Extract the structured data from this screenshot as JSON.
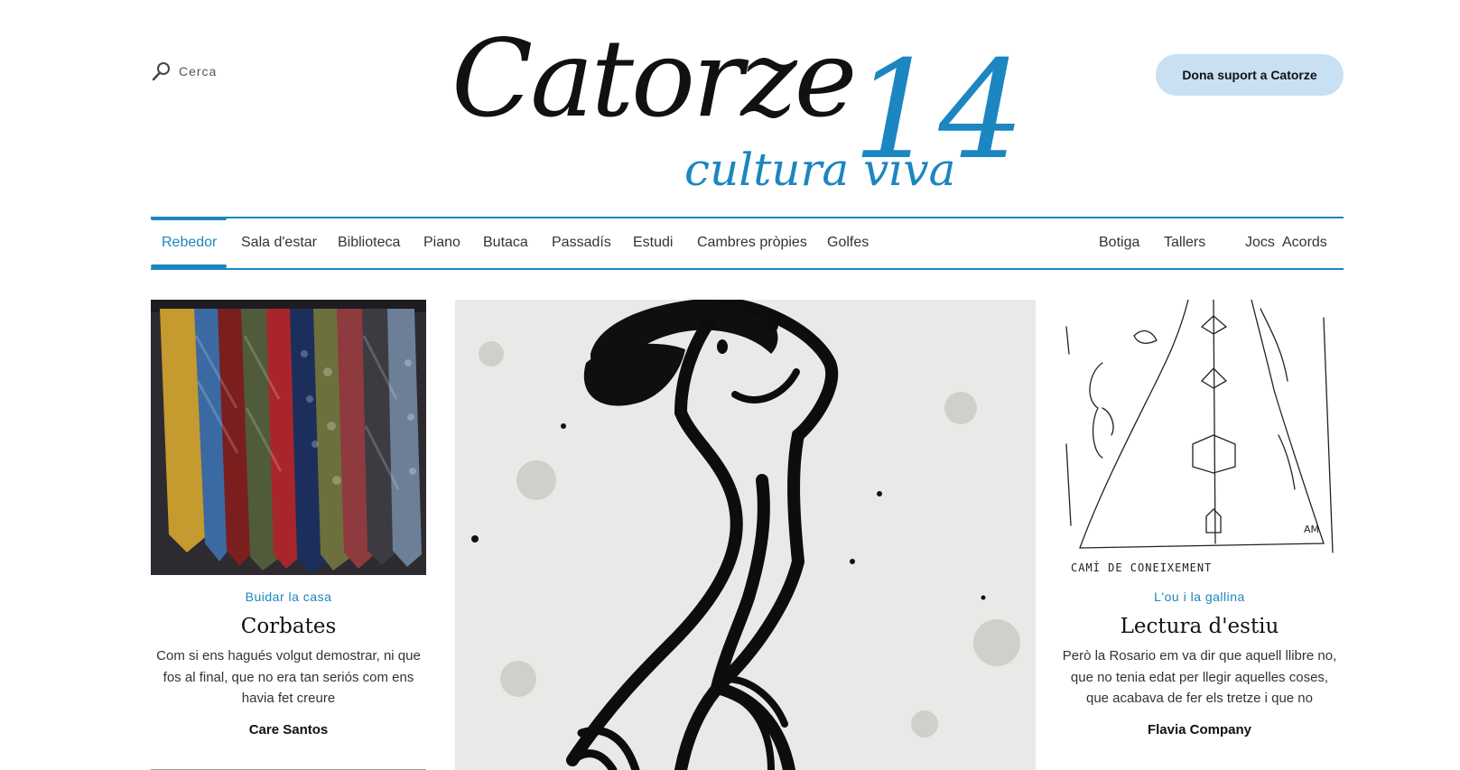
{
  "header": {
    "search_label": "Cerca",
    "logo_word": "Catorze",
    "logo_number": "14",
    "logo_tagline": "cultura viva",
    "support_button": "Dona suport a Catorze"
  },
  "nav": {
    "left": [
      "Rebedor",
      "Sala d'estar",
      "Biblioteca",
      "Piano",
      "Butaca",
      "Passadís",
      "Estudi",
      "Cambres pròpies",
      "Golfes"
    ],
    "right": [
      "Botiga",
      "Tallers",
      "Jocs",
      "Acords"
    ],
    "active": "Rebedor"
  },
  "articles": [
    {
      "kicker": "Buidar la casa",
      "title": "Corbates",
      "excerpt": "Com si ens hagués volgut demostrar, ni que fos al final, que no era tan seriós com ens havia fet creure",
      "author": "Care Santos",
      "image": "neckties-photo"
    },
    {
      "image": "etching-figure"
    },
    {
      "kicker": "L'ou i la gallina",
      "title": "Lectura d'estiu",
      "excerpt": "Però la Rosario em va dir que aquell llibre no, que no tenia edat per llegir aquelles coses, que acabava de fer els tretze i que no",
      "author": "Flavia Company",
      "image": "sketch-path-drawing",
      "sketch_caption": "CAMÍ DE CONEIXEMENT",
      "sketch_signature": "AM"
    }
  ],
  "colors": {
    "accent": "#1b86c0",
    "support_bg": "#c9dff2"
  }
}
